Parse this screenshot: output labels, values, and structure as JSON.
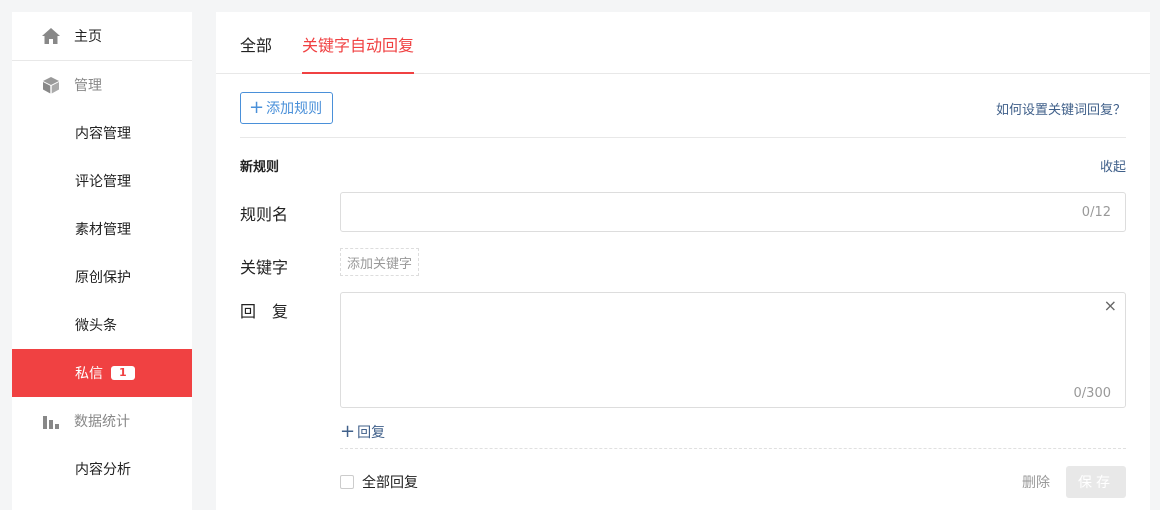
{
  "sidebar": {
    "home": "主页",
    "manage": "管理",
    "items": [
      "内容管理",
      "评论管理",
      "素材管理",
      "原创保护",
      "微头条"
    ],
    "messages": "私信",
    "messages_badge": "1",
    "stats": "数据统计",
    "analysis": "内容分析",
    "accent": "#f04142"
  },
  "tabs": [
    "全部",
    "关键字自动回复"
  ],
  "toolbar": {
    "add_rule": "添加规则",
    "help": "如何设置关键词回复？"
  },
  "rule": {
    "title": "新规则",
    "collapse": "收起",
    "name_label": "规则名",
    "name_counter": "0/12",
    "keyword_label": "关键字",
    "keyword_button": "添加关键字",
    "reply_label": "回　复",
    "reply_counter": "0/300",
    "add_reply": "回复",
    "all_reply": "全部回复",
    "delete": "删除",
    "save": "保存"
  }
}
